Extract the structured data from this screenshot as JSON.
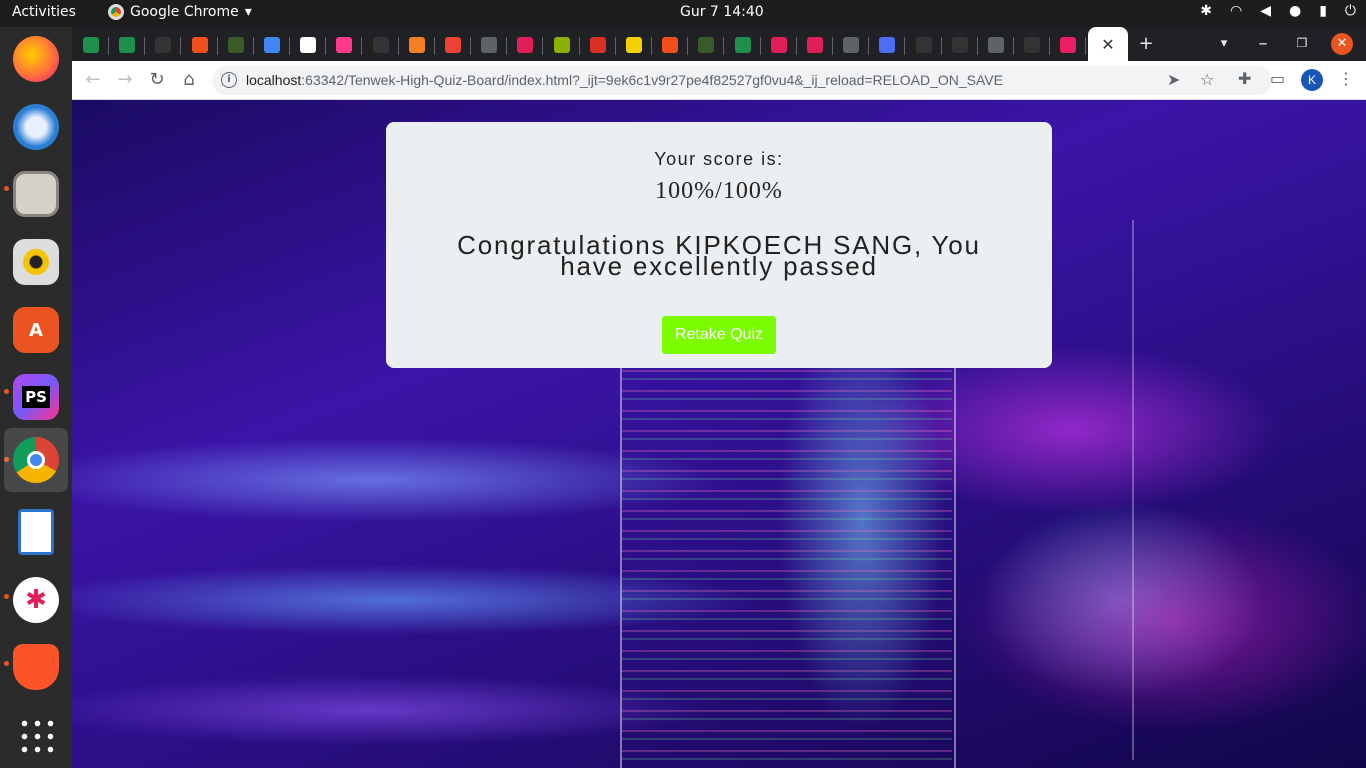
{
  "system": {
    "activities_label": "Activities",
    "app_menu_label": "Google Chrome",
    "clock": "Gur 7  14:40",
    "dropdown_glyph": "▾"
  },
  "browser": {
    "url_host": "localhost",
    "url_rest": ":63342/Tenwek-High-Quiz-Board/index.html?_ijt=9ek6c1v9r27pe4f82527gf0vu4&_ij_reload=RELOAD_ON_SAVE",
    "profile_initial": "K",
    "tab_favicons": [
      "#1f8f4e",
      "#1f8f4e",
      "#333333",
      "#f24e1e",
      "#3a5a2a",
      "#4285f4",
      "#ffffff",
      "#ff3a8c",
      "#333333",
      "#f48024",
      "#ea4335",
      "#5f6368",
      "#e01e5a",
      "#8ab000",
      "#d93025",
      "#f5d000",
      "#f24e1e",
      "#3a5a2a",
      "#1f8f4e",
      "#e01e5a",
      "#e01e5a",
      "#5f6368",
      "#4c6ef5",
      "#333333",
      "#333333",
      "#5f6368",
      "#333333",
      "#e91e63"
    ]
  },
  "quiz_result": {
    "score_label": "Your score is:",
    "score_value": "100%/100%",
    "message": "Congratulations KIPKOECH SANG, You have excellently passed",
    "retake_button_label": "Retake Quiz"
  },
  "colors": {
    "retake_button": "#7cfc00",
    "card_background": "#eceff1"
  }
}
